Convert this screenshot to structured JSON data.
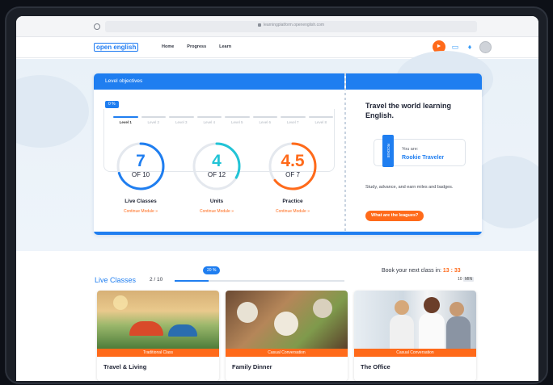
{
  "browser": {
    "url": "learningplatform.openenglish.com"
  },
  "header": {
    "logo": "open english",
    "nav": [
      "Home",
      "Progress",
      "Learn"
    ],
    "icons": [
      "megaphone-icon",
      "ticket-icon",
      "bell-icon",
      "avatar"
    ]
  },
  "objectives": {
    "title": "Level objectives",
    "progress_label": "0 %",
    "levels": [
      "Level 1",
      "Level 2",
      "Level 3",
      "Level 4",
      "Level 5",
      "Level 6",
      "Level 7",
      "Level 8"
    ],
    "stats": [
      {
        "value": "7",
        "of": "OF 10",
        "name": "Live Classes",
        "link": "Continue Module »",
        "color": "#1f7ef0",
        "fraction": 0.7
      },
      {
        "value": "4",
        "of": "OF 12",
        "name": "Units",
        "link": "Continue Module »",
        "color": "#22c4d6",
        "fraction": 0.3333
      },
      {
        "value": "4.5",
        "of": "OF 7",
        "name": "Practice",
        "link": "Continue Module »",
        "color": "#ff6a1a",
        "fraction": 0.6429
      }
    ],
    "headline": "Travel the world learning English.",
    "you_are": "You are:",
    "rank": "Rookie Traveler",
    "badge_text": "ROOKIE",
    "description": "Study, advance, and earn miles and badges.",
    "league_button": "What are the leagues?"
  },
  "live_classes": {
    "title": "Live Classes",
    "count": "2 / 10",
    "progress_label": "20 %",
    "progress": 0.2,
    "book_text": "Book your next class in:",
    "timer": "13 : 33",
    "minutes_value": "10",
    "minutes_label": "MIN",
    "cards": [
      {
        "tag": "Traditional Class",
        "title": "Travel & Living"
      },
      {
        "tag": "Casual Conversation",
        "title": "Family Dinner"
      },
      {
        "tag": "Casual Conversation",
        "title": "The Office"
      }
    ]
  },
  "colors": {
    "primary": "#1f7ef0",
    "accent": "#ff6a1a",
    "cyan": "#22c4d6"
  }
}
